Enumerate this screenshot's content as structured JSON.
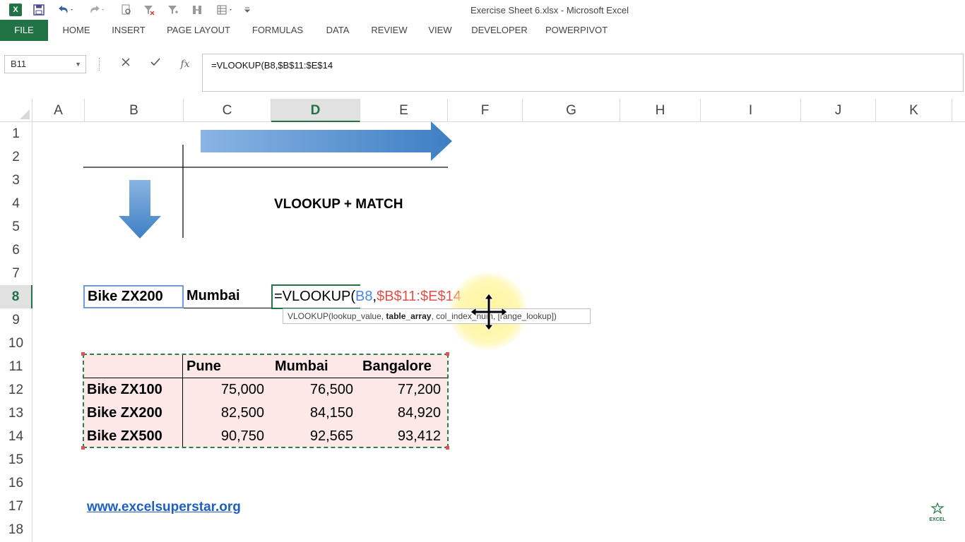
{
  "app": {
    "title": "Exercise Sheet 6.xlsx - Microsoft Excel",
    "logo_letter": "X"
  },
  "ribbon": {
    "tabs": [
      "FILE",
      "HOME",
      "INSERT",
      "PAGE LAYOUT",
      "FORMULAS",
      "DATA",
      "REVIEW",
      "VIEW",
      "DEVELOPER",
      "POWERPIVOT"
    ]
  },
  "formula_bar": {
    "name_box": "B11",
    "formula": "=VLOOKUP(B8,$B$11:$E$14"
  },
  "sheet": {
    "columns": [
      "A",
      "B",
      "C",
      "D",
      "E",
      "F",
      "G",
      "H",
      "I",
      "J",
      "K"
    ],
    "active_column": "D",
    "rows": [
      "1",
      "2",
      "3",
      "4",
      "5",
      "6",
      "7",
      "8",
      "9",
      "10",
      "11",
      "12",
      "13",
      "14",
      "15",
      "16",
      "17",
      "18"
    ],
    "active_row": "8",
    "heading": "VLOOKUP + MATCH",
    "lookup": {
      "product": "Bike ZX200",
      "city": "Mumbai",
      "formula_prefix": "=VLOOKUP(",
      "formula_ref1": "B8",
      "formula_comma": ",",
      "formula_ref2": "$B$11:$E$14"
    },
    "tooltip": {
      "fn": "VLOOKUP(lookup_value, ",
      "bold_arg": "table_array",
      "rest": ", col_index_num, [range_lookup])"
    },
    "table": {
      "headers": [
        "",
        "Pune",
        "Mumbai",
        "Bangalore"
      ],
      "rows": [
        {
          "label": "Bike ZX100",
          "values": [
            "75,000",
            "76,500",
            "77,200"
          ]
        },
        {
          "label": "Bike ZX200",
          "values": [
            "82,500",
            "84,150",
            "84,920"
          ]
        },
        {
          "label": "Bike ZX500",
          "values": [
            "90,750",
            "92,565",
            "93,412"
          ]
        }
      ]
    },
    "link": "www.excelsuperstar.org",
    "watermark": "EXCEL"
  },
  "colors": {
    "excel_green": "#217346",
    "table_fill": "#fce9e7",
    "ref1_color": "#4a86e8",
    "ref2_color": "#e0514a",
    "arrow_blue": "#3f86c9",
    "link_color": "#1f5fbf"
  }
}
